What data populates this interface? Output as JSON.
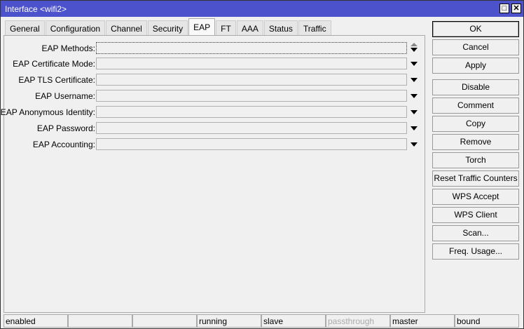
{
  "window": {
    "title": "Interface <wifi2>",
    "maximize_icon": "maximize-icon",
    "close_icon": "close-icon"
  },
  "tabs": [
    {
      "label": "General"
    },
    {
      "label": "Configuration"
    },
    {
      "label": "Channel"
    },
    {
      "label": "Security"
    },
    {
      "label": "EAP",
      "active": true
    },
    {
      "label": "FT"
    },
    {
      "label": "AAA"
    },
    {
      "label": "Status"
    },
    {
      "label": "Traffic"
    }
  ],
  "fields": [
    {
      "label": "EAP Methods:",
      "value": "",
      "control": "up-down"
    },
    {
      "label": "EAP Certificate Mode:",
      "value": "",
      "control": "dropdown"
    },
    {
      "label": "EAP TLS Certificate:",
      "value": "",
      "control": "dropdown"
    },
    {
      "label": "EAP Username:",
      "value": "",
      "control": "dropdown"
    },
    {
      "label": "EAP Anonymous Identity:",
      "value": "",
      "control": "dropdown"
    },
    {
      "label": "EAP Password:",
      "value": "",
      "control": "dropdown"
    },
    {
      "label": "EAP Accounting:",
      "value": "",
      "control": "dropdown"
    }
  ],
  "buttons": [
    "OK",
    "Cancel",
    "Apply",
    "Disable",
    "Comment",
    "Copy",
    "Remove",
    "Torch",
    "Reset Traffic Counters",
    "WPS Accept",
    "WPS Client",
    "Scan...",
    "Freq. Usage..."
  ],
  "status": [
    "enabled",
    "",
    "",
    "running",
    "slave",
    "passthrough",
    "master",
    "bound"
  ]
}
